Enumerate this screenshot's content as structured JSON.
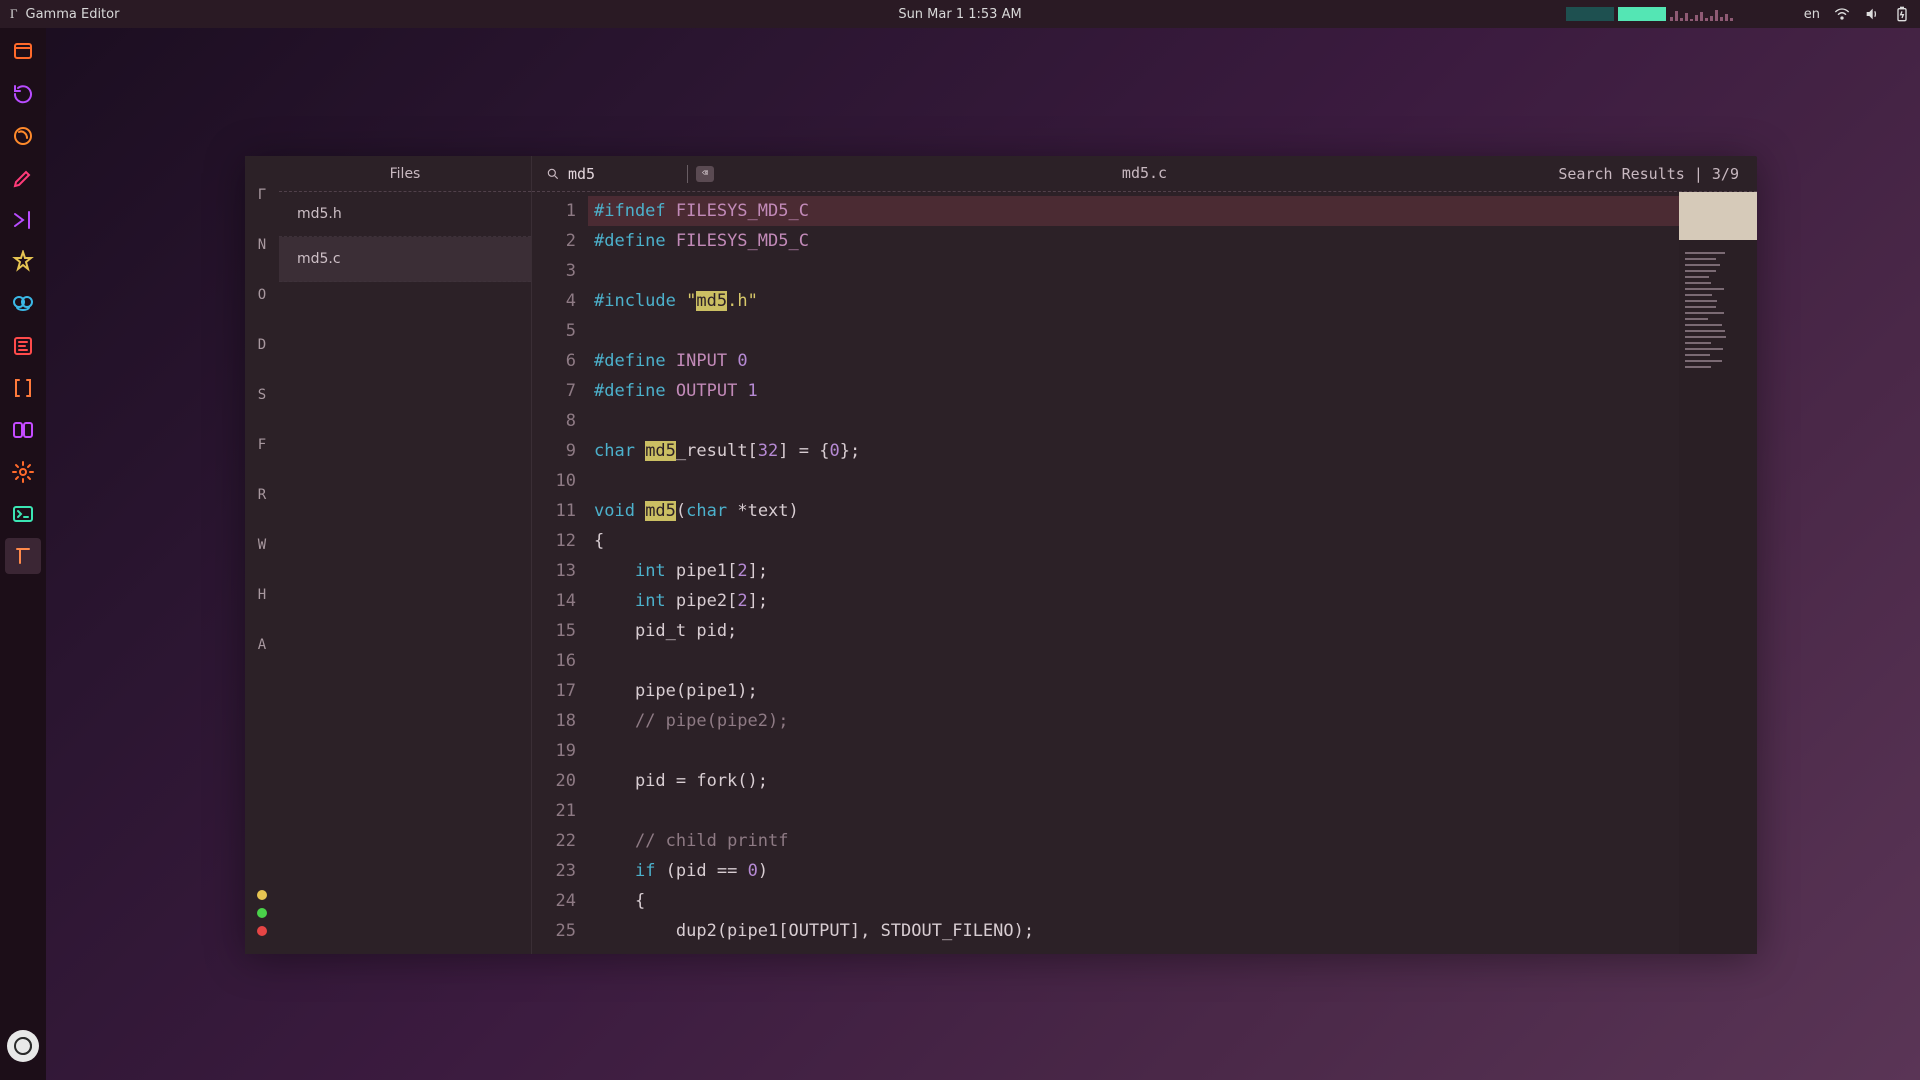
{
  "topbar": {
    "app_title": "Gamma Editor",
    "clock": "Sun Mar 1  1:53 AM",
    "lang": "en"
  },
  "dock": {
    "apps": [
      {
        "name": "files",
        "color": "#ff6a2b"
      },
      {
        "name": "refresh",
        "color": "#b84cff"
      },
      {
        "name": "firefox",
        "color": "#ff8a2b"
      },
      {
        "name": "edit",
        "color": "#ff3b79"
      },
      {
        "name": "vscode",
        "color": "#b84cff"
      },
      {
        "name": "build",
        "color": "#e6c452"
      },
      {
        "name": "audio",
        "color": "#3bb8e6"
      },
      {
        "name": "filezilla",
        "color": "#ff4b4b"
      },
      {
        "name": "brackets",
        "color": "#ff7a3b"
      },
      {
        "name": "panels",
        "color": "#c44bff"
      },
      {
        "name": "settings",
        "color": "#ff6a2b"
      },
      {
        "name": "terminal",
        "color": "#3be6b4"
      },
      {
        "name": "gamma",
        "color": "#ff8a4b"
      }
    ],
    "dock_active_index": 12
  },
  "letters": [
    "Γ",
    "N",
    "O",
    "D",
    "S",
    "F",
    "R",
    "W",
    "H",
    "A"
  ],
  "files_pane": {
    "header": "Files",
    "items": [
      "md5.h",
      "md5.c"
    ],
    "selected_index": 1
  },
  "search": {
    "query": "md5",
    "filename": "md5.c",
    "results_label": "Search Results | 3/9"
  },
  "code": {
    "lines": [
      {
        "n": 1,
        "hl": true,
        "tokens": [
          {
            "c": "tok-pp",
            "t": "#ifndef "
          },
          {
            "c": "tok-def",
            "t": "FILESYS_MD5_C"
          }
        ]
      },
      {
        "n": 2,
        "tokens": [
          {
            "c": "tok-pp",
            "t": "#define "
          },
          {
            "c": "tok-def",
            "t": "FILESYS_MD5_C"
          }
        ]
      },
      {
        "n": 3,
        "tokens": []
      },
      {
        "n": 4,
        "tokens": [
          {
            "c": "tok-pp",
            "t": "#include "
          },
          {
            "c": "tok-str",
            "t": "\""
          },
          {
            "c": "tok-match",
            "t": "md5"
          },
          {
            "c": "tok-str",
            "t": ".h\""
          }
        ]
      },
      {
        "n": 5,
        "tokens": []
      },
      {
        "n": 6,
        "tokens": [
          {
            "c": "tok-pp",
            "t": "#define "
          },
          {
            "c": "tok-def",
            "t": "INPUT "
          },
          {
            "c": "tok-num",
            "t": "0"
          }
        ]
      },
      {
        "n": 7,
        "tokens": [
          {
            "c": "tok-pp",
            "t": "#define "
          },
          {
            "c": "tok-def",
            "t": "OUTPUT "
          },
          {
            "c": "tok-num",
            "t": "1"
          }
        ]
      },
      {
        "n": 8,
        "tokens": []
      },
      {
        "n": 9,
        "tokens": [
          {
            "c": "tok-kw",
            "t": "char "
          },
          {
            "c": "tok-match",
            "t": "md5"
          },
          {
            "c": "",
            "t": "_result["
          },
          {
            "c": "tok-num",
            "t": "32"
          },
          {
            "c": "",
            "t": "] = {"
          },
          {
            "c": "tok-num",
            "t": "0"
          },
          {
            "c": "",
            "t": "};"
          }
        ]
      },
      {
        "n": 10,
        "tokens": []
      },
      {
        "n": 11,
        "tokens": [
          {
            "c": "tok-kw",
            "t": "void "
          },
          {
            "c": "tok-match",
            "t": "md5"
          },
          {
            "c": "",
            "t": "("
          },
          {
            "c": "tok-kw",
            "t": "char "
          },
          {
            "c": "",
            "t": "*text)"
          }
        ]
      },
      {
        "n": 12,
        "tokens": [
          {
            "c": "",
            "t": "{"
          }
        ]
      },
      {
        "n": 13,
        "tokens": [
          {
            "c": "",
            "t": "    "
          },
          {
            "c": "tok-kw",
            "t": "int "
          },
          {
            "c": "",
            "t": "pipe1["
          },
          {
            "c": "tok-num",
            "t": "2"
          },
          {
            "c": "",
            "t": "];"
          }
        ]
      },
      {
        "n": 14,
        "tokens": [
          {
            "c": "",
            "t": "    "
          },
          {
            "c": "tok-kw",
            "t": "int "
          },
          {
            "c": "",
            "t": "pipe2["
          },
          {
            "c": "tok-num",
            "t": "2"
          },
          {
            "c": "",
            "t": "];"
          }
        ]
      },
      {
        "n": 15,
        "tokens": [
          {
            "c": "",
            "t": "    pid_t pid;"
          }
        ]
      },
      {
        "n": 16,
        "tokens": []
      },
      {
        "n": 17,
        "tokens": [
          {
            "c": "",
            "t": "    pipe(pipe1);"
          }
        ]
      },
      {
        "n": 18,
        "tokens": [
          {
            "c": "",
            "t": "    "
          },
          {
            "c": "tok-cmt",
            "t": "// pipe(pipe2);"
          }
        ]
      },
      {
        "n": 19,
        "tokens": []
      },
      {
        "n": 20,
        "tokens": [
          {
            "c": "",
            "t": "    pid = fork();"
          }
        ]
      },
      {
        "n": 21,
        "tokens": []
      },
      {
        "n": 22,
        "tokens": [
          {
            "c": "",
            "t": "    "
          },
          {
            "c": "tok-cmt",
            "t": "// child printf"
          }
        ]
      },
      {
        "n": 23,
        "tokens": [
          {
            "c": "",
            "t": "    "
          },
          {
            "c": "tok-pp",
            "t": "if"
          },
          {
            "c": "",
            "t": " (pid == "
          },
          {
            "c": "tok-num",
            "t": "0"
          },
          {
            "c": "",
            "t": ")"
          }
        ]
      },
      {
        "n": 24,
        "tokens": [
          {
            "c": "",
            "t": "    {"
          }
        ]
      },
      {
        "n": 25,
        "tokens": [
          {
            "c": "",
            "t": "        dup2(pipe1[OUTPUT], STDOUT_FILENO);"
          }
        ]
      }
    ]
  }
}
